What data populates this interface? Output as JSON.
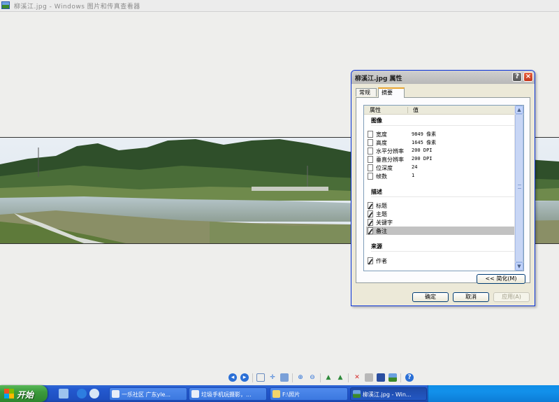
{
  "viewer": {
    "title": "柳溪江.jpg - Windows 图片和传真查看器"
  },
  "dialog": {
    "title": "柳溪江.jpg 属性",
    "help_label": "?",
    "close_label": "×",
    "tabs": [
      {
        "label": "常规",
        "active": false
      },
      {
        "label": "摘要",
        "active": true
      }
    ],
    "columns": {
      "property": "属性",
      "value": "值"
    },
    "sections": {
      "image": {
        "label": "图像",
        "rows": [
          {
            "name": "宽度",
            "value": "9849 像素"
          },
          {
            "name": "高度",
            "value": "1645 像素"
          },
          {
            "name": "水平分辨率",
            "value": "200 DPI"
          },
          {
            "name": "垂直分辨率",
            "value": "200 DPI"
          },
          {
            "name": "位深度",
            "value": "24"
          },
          {
            "name": "帧数",
            "value": "1"
          }
        ]
      },
      "description": {
        "label": "描述",
        "rows": [
          {
            "name": "标题",
            "value": ""
          },
          {
            "name": "主题",
            "value": ""
          },
          {
            "name": "关键字",
            "value": ""
          },
          {
            "name": "备注",
            "value": "",
            "selected": true
          }
        ]
      },
      "origin": {
        "label": "来源",
        "rows": [
          {
            "name": "作者",
            "value": ""
          }
        ]
      }
    },
    "simple_button": "<< 简化(M)",
    "ok_button": "确定",
    "cancel_button": "取消",
    "apply_button": "应用(A)",
    "scroll_up": "▲",
    "scroll_down": "▼"
  },
  "toolbar": {
    "items": [
      "previous-icon",
      "next-icon",
      "best-fit-icon",
      "actual-size-icon",
      "slideshow-icon",
      "zoom-in-icon",
      "zoom-out-icon",
      "rotate-cw-icon",
      "rotate-ccw-icon",
      "delete-icon",
      "print-icon",
      "save-icon",
      "edit-icon",
      "help-icon"
    ]
  },
  "taskbar": {
    "start_label": "开始",
    "tasks": [
      {
        "label": "一乐社区 广东yle...",
        "active": false
      },
      {
        "label": "垃圾手机玩摄影，...",
        "active": false
      },
      {
        "label": "F:\\照片",
        "active": false
      },
      {
        "label": "柳溪江.jpg - Win...",
        "active": true
      }
    ]
  },
  "colors": {
    "title_active_border": "#0831d9",
    "close_red": "#c2351b",
    "tab_highlight": "#e8a532",
    "taskbar_blue": "#245ad0",
    "start_green": "#3c9a3c",
    "tray_blue": "#1290ea"
  }
}
